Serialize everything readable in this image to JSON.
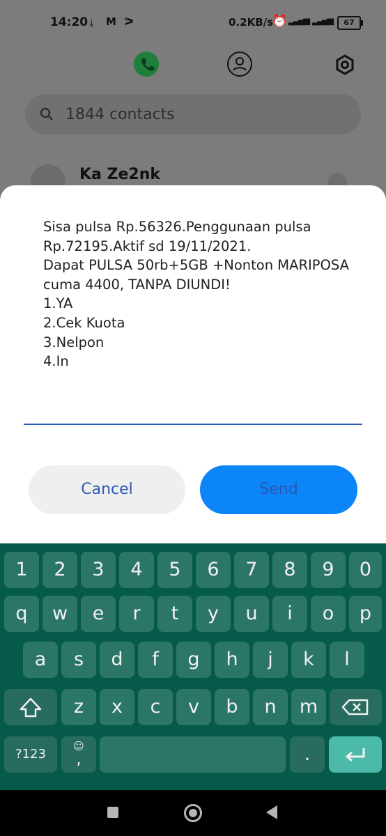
{
  "status_bar": {
    "time": "14:20",
    "speed": "0.2KB/s",
    "battery": "67"
  },
  "search": {
    "placeholder": "1844 contacts"
  },
  "contact": {
    "name": "Ka Ze2nk"
  },
  "dialog": {
    "message": "Sisa pulsa Rp.56326.Penggunaan pulsa Rp.72195.Aktif sd 19/11/2021.\nDapat PULSA 50rb+5GB +Nonton MARIPOSA cuma 4400, TANPA DIUNDI!\n1.YA\n2.Cek Kuota\n3.Nelpon\n4.In",
    "cancel_label": "Cancel",
    "send_label": "Send"
  },
  "keyboard": {
    "row_numbers": [
      "1",
      "2",
      "3",
      "4",
      "5",
      "6",
      "7",
      "8",
      "9",
      "0"
    ],
    "row1": [
      "q",
      "w",
      "e",
      "r",
      "t",
      "y",
      "u",
      "i",
      "o",
      "p"
    ],
    "row2": [
      "a",
      "s",
      "d",
      "f",
      "g",
      "h",
      "j",
      "k",
      "l"
    ],
    "row3": [
      "z",
      "x",
      "c",
      "v",
      "b",
      "n",
      "m"
    ],
    "symbols_label": "?123",
    "comma": ",",
    "period": "."
  },
  "colors": {
    "keyboard_bg": "#065a4a",
    "key_bg": "#2c7667",
    "enter_key": "#4cbaa8",
    "send_button": "#0c85f8",
    "accent_text": "#2d58b5"
  }
}
